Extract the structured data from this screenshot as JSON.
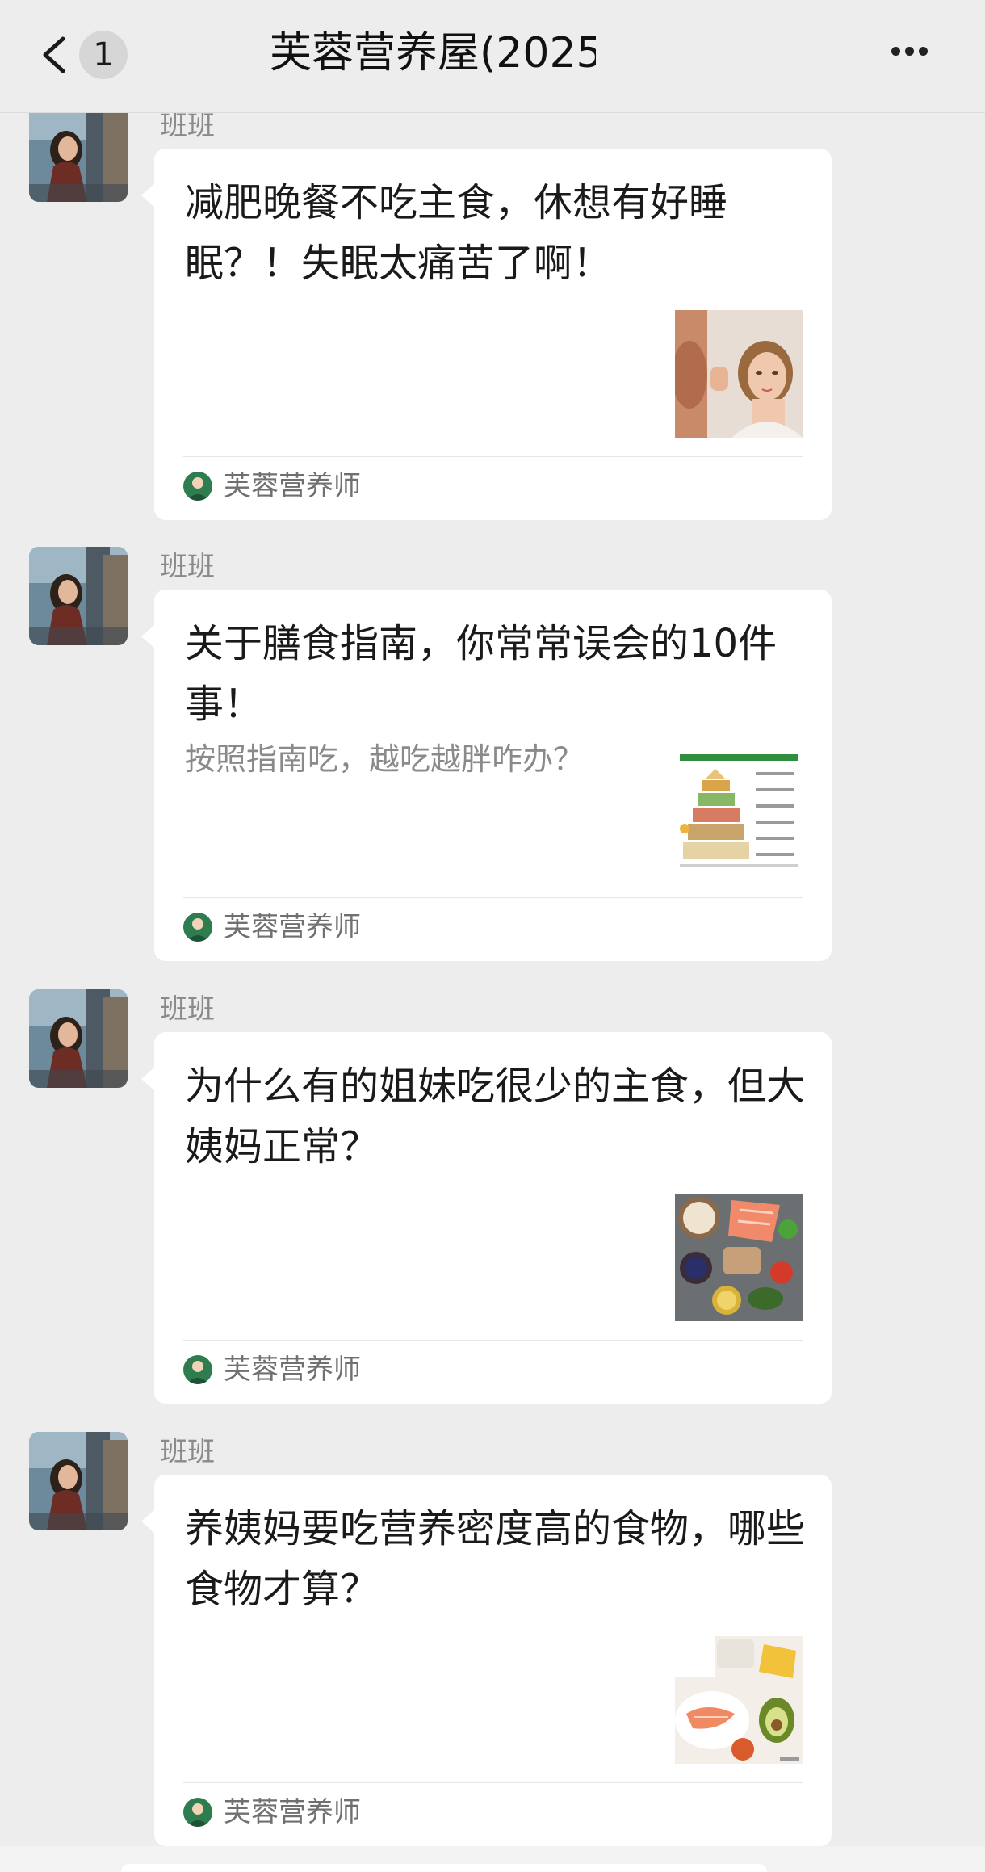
{
  "header": {
    "unread_count": "1",
    "title": "芙蓉营养屋(2025"
  },
  "messages": [
    {
      "sender": "班班",
      "title": "减肥晚餐不吃主食，休想有好睡眠？！失眠太痛苦了啊！",
      "description": "",
      "source": "芙蓉营养师",
      "thumb_icon": "woman-skincare-thumbnail"
    },
    {
      "sender": "班班",
      "title": "关于膳食指南，你常常误会的10件事！",
      "description": "按照指南吃，越吃越胖咋办？",
      "source": "芙蓉营养师",
      "thumb_icon": "food-pyramid-thumbnail"
    },
    {
      "sender": "班班",
      "title": "为什么有的姐妹吃很少的主食，但大姨妈正常？",
      "description": "",
      "source": "芙蓉营养师",
      "thumb_icon": "healthy-food-thumbnail"
    },
    {
      "sender": "班班",
      "title": "养姨妈要吃营养密度高的食物，哪些食物才算？",
      "description": "",
      "source": "芙蓉营养师",
      "thumb_icon": "nutrient-food-thumbnail"
    }
  ]
}
